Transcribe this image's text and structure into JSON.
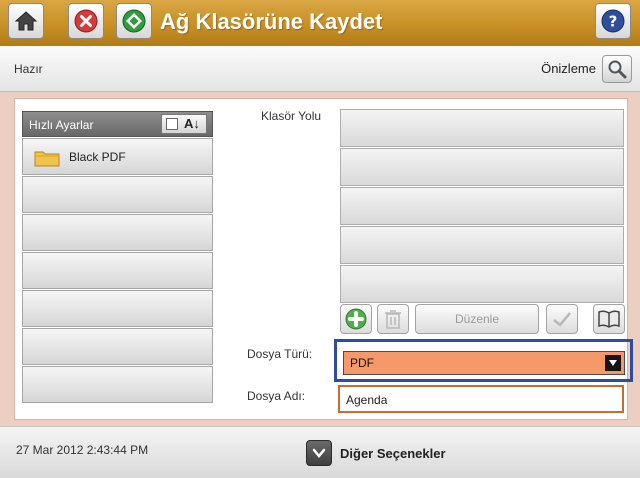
{
  "titlebar": {
    "title": "Ağ Klasörüne Kaydet",
    "icons": {
      "home": "home-icon",
      "stop": "stop-icon",
      "start": "start-icon",
      "help": "help-icon"
    },
    "colors": {
      "bar": "#c88f25",
      "stop": "#d63b3b",
      "start": "#2e9d3c"
    }
  },
  "status": {
    "text": "Hazır",
    "preview_label": "Önizleme",
    "preview_icon": "magnifier-icon"
  },
  "quick_sets": {
    "header": "Hızlı Ayarlar",
    "sort_glyph": "↓",
    "sort_glyph_prefix": "A",
    "items": [
      {
        "label": "Black PDF",
        "icon": "folder-icon"
      },
      {
        "label": ""
      },
      {
        "label": ""
      },
      {
        "label": ""
      },
      {
        "label": ""
      },
      {
        "label": ""
      },
      {
        "label": ""
      },
      {
        "label": ""
      }
    ]
  },
  "folder_path": {
    "label": "Klasör Yolu",
    "slots": [
      "",
      "",
      "",
      "",
      ""
    ]
  },
  "toolbar": {
    "add_icon": "plus-icon",
    "delete_icon": "trash-icon",
    "edit_label": "Düzenle",
    "confirm_icon": "checkmark-icon",
    "browse_icon": "book-icon"
  },
  "file_type": {
    "label": "Dosya Türü:",
    "value": "PDF",
    "accent": "#f5996b"
  },
  "file_name": {
    "label": "Dosya Adı:",
    "value": "Agenda"
  },
  "footer": {
    "datetime": "27 Mar 2012 2:43:44 PM",
    "more_label": "Diğer Seçenekler",
    "more_icon": "chevron-down-icon"
  }
}
